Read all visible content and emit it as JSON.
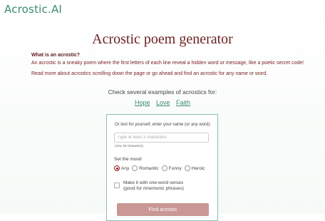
{
  "header": {
    "logo": "Acrostic.AI"
  },
  "page": {
    "title": "Acrostic poem generator",
    "intro_question": "What is an acrostic?",
    "intro_text": "An acrostic is a sneaky poem where the first letters of each line reveal a hidden word or message, like a poetic secret code!",
    "intro_more": "Read more about acrostics scrolling down the page or go ahead and find an acrostic for any name or word."
  },
  "examples": {
    "heading": "Check several examples of acrostics for:",
    "links": [
      "Hope",
      "Love",
      "Faith"
    ]
  },
  "form": {
    "prompt": "Or test for yourself, enter your name (or any word):",
    "input_placeholder": "Type at least 3 characters",
    "input_value": "",
    "char_hint": "(max 30 characters)",
    "mood_label": "Set the mood",
    "moods": [
      "Any",
      "Romantic",
      "Funny",
      "Heroic"
    ],
    "selected_mood": "Any",
    "oneword_line1": "Make it with one-word verses",
    "oneword_line2": "(good for mnemonic phrases)",
    "oneword_checked": false,
    "submit_label": "Find acrostic"
  },
  "colors": {
    "brand_green": "#3d8a74",
    "title_maroon": "#6b2322",
    "button_disabled": "#c99795",
    "radio_selected": "#8c1d1d"
  }
}
